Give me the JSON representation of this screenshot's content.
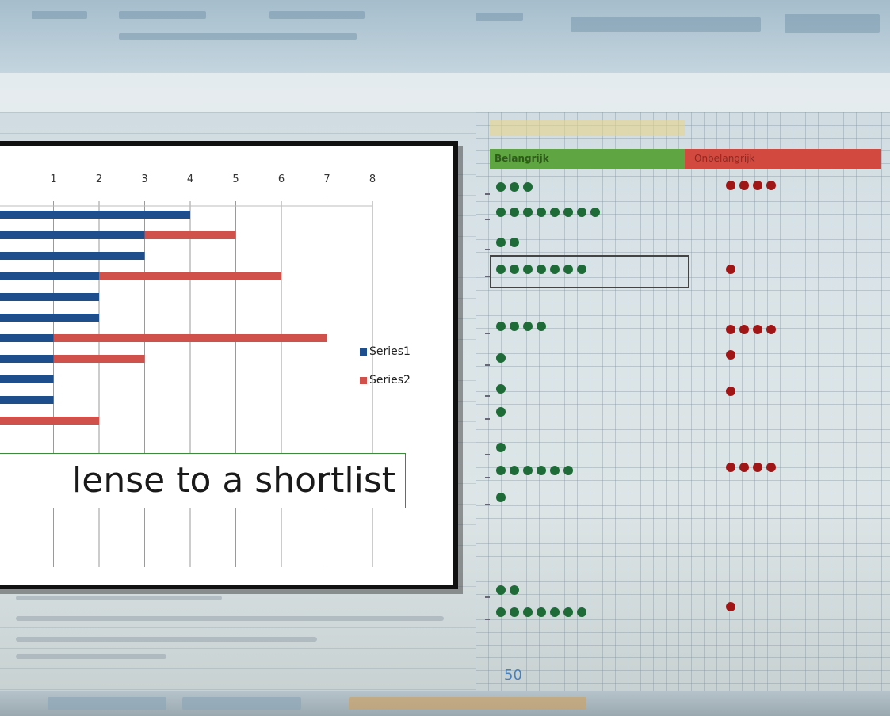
{
  "spreadsheet": {
    "header_left": "Belangrijk",
    "header_right": "Onbelangrijk",
    "page_indicator": "50",
    "green_rows": [
      {
        "y": 236,
        "count": 3
      },
      {
        "y": 268,
        "count": 8
      },
      {
        "y": 306,
        "count": 2
      },
      {
        "y": 340,
        "count": 7
      },
      {
        "y": 412,
        "count": 4
      },
      {
        "y": 452,
        "count": 1
      },
      {
        "y": 491,
        "count": 1
      },
      {
        "y": 520,
        "count": 1
      },
      {
        "y": 565,
        "count": 1
      },
      {
        "y": 594,
        "count": 6
      },
      {
        "y": 628,
        "count": 1
      },
      {
        "y": 745,
        "count": 2
      },
      {
        "y": 773,
        "count": 7
      }
    ],
    "red_rows": [
      {
        "y": 234,
        "count": 4
      },
      {
        "y": 340,
        "count": 1
      },
      {
        "y": 416,
        "count": 4
      },
      {
        "y": 448,
        "count": 1
      },
      {
        "y": 494,
        "count": 1
      },
      {
        "y": 590,
        "count": 4
      },
      {
        "y": 766,
        "count": 1
      }
    ]
  },
  "caption": {
    "text": "lense to a shortlist"
  },
  "colors": {
    "series1": "#1f4e8c",
    "series2": "#d0504c",
    "green_dot": "#1e6b38",
    "red_dot": "#a01617"
  },
  "chart_data": {
    "type": "bar",
    "orientation": "horizontal",
    "stacked": true,
    "x_ticks": [
      "1",
      "2",
      "3",
      "4",
      "5",
      "6",
      "7",
      "8"
    ],
    "xlim": [
      0,
      8
    ],
    "series": [
      {
        "name": "Series1",
        "values": [
          4,
          3,
          3,
          2,
          2,
          2,
          1,
          1,
          1,
          1,
          0
        ]
      },
      {
        "name": "Series2",
        "values": [
          0,
          2,
          0,
          4,
          0,
          0,
          6,
          2,
          0,
          0,
          2
        ]
      }
    ],
    "legend_position": "right",
    "grid": true
  }
}
